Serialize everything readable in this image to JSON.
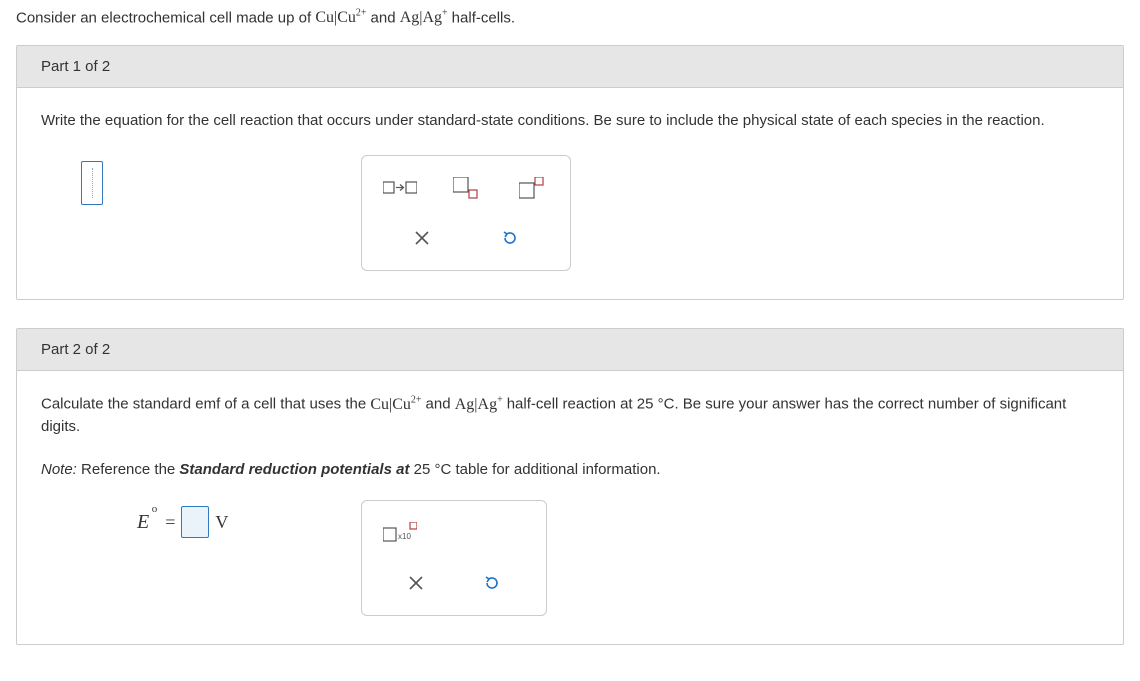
{
  "intro": {
    "prefix": "Consider an electrochemical cell made up of ",
    "cell1_base": "Cu|Cu",
    "cell1_sup": "2+",
    "mid": " and ",
    "cell2_base": "Ag|Ag",
    "cell2_sup": "+",
    "suffix": " half-cells."
  },
  "part1": {
    "header": "Part 1 of 2",
    "prompt": "Write the equation for the cell reaction that occurs under standard-state conditions. Be sure to include the physical state of each species in the reaction."
  },
  "part2": {
    "header": "Part 2 of 2",
    "prompt_prefix": "Calculate the standard emf of a cell that uses the ",
    "cell1_base": "Cu|Cu",
    "cell1_sup": "2+",
    "mid": " and ",
    "cell2_base": "Ag|Ag",
    "cell2_sup": "+",
    "prompt_suffix": " half-cell reaction at 25 °C. Be sure your answer has the correct number of significant digits.",
    "note_prefix": "Note:",
    "note_mid": " Reference the ",
    "note_bold": "Standard reduction potentials at ",
    "note_temp": "25 °C",
    "note_suffix": " table for additional information.",
    "emf_var": "E",
    "emf_sup": "o",
    "emf_eq": "=",
    "emf_unit": "V"
  },
  "palette": {
    "arrow_label": "yields-arrow",
    "subscript_label": "subscript",
    "superscript_label": "superscript",
    "sci_label": "scientific-notation",
    "clear_label": "clear",
    "reset_label": "reset"
  },
  "colors": {
    "border": "#cccccc",
    "header_bg": "#e6e6e6",
    "input_border": "#2f7abf",
    "icon": "#555555",
    "reset": "#1a73c9"
  }
}
